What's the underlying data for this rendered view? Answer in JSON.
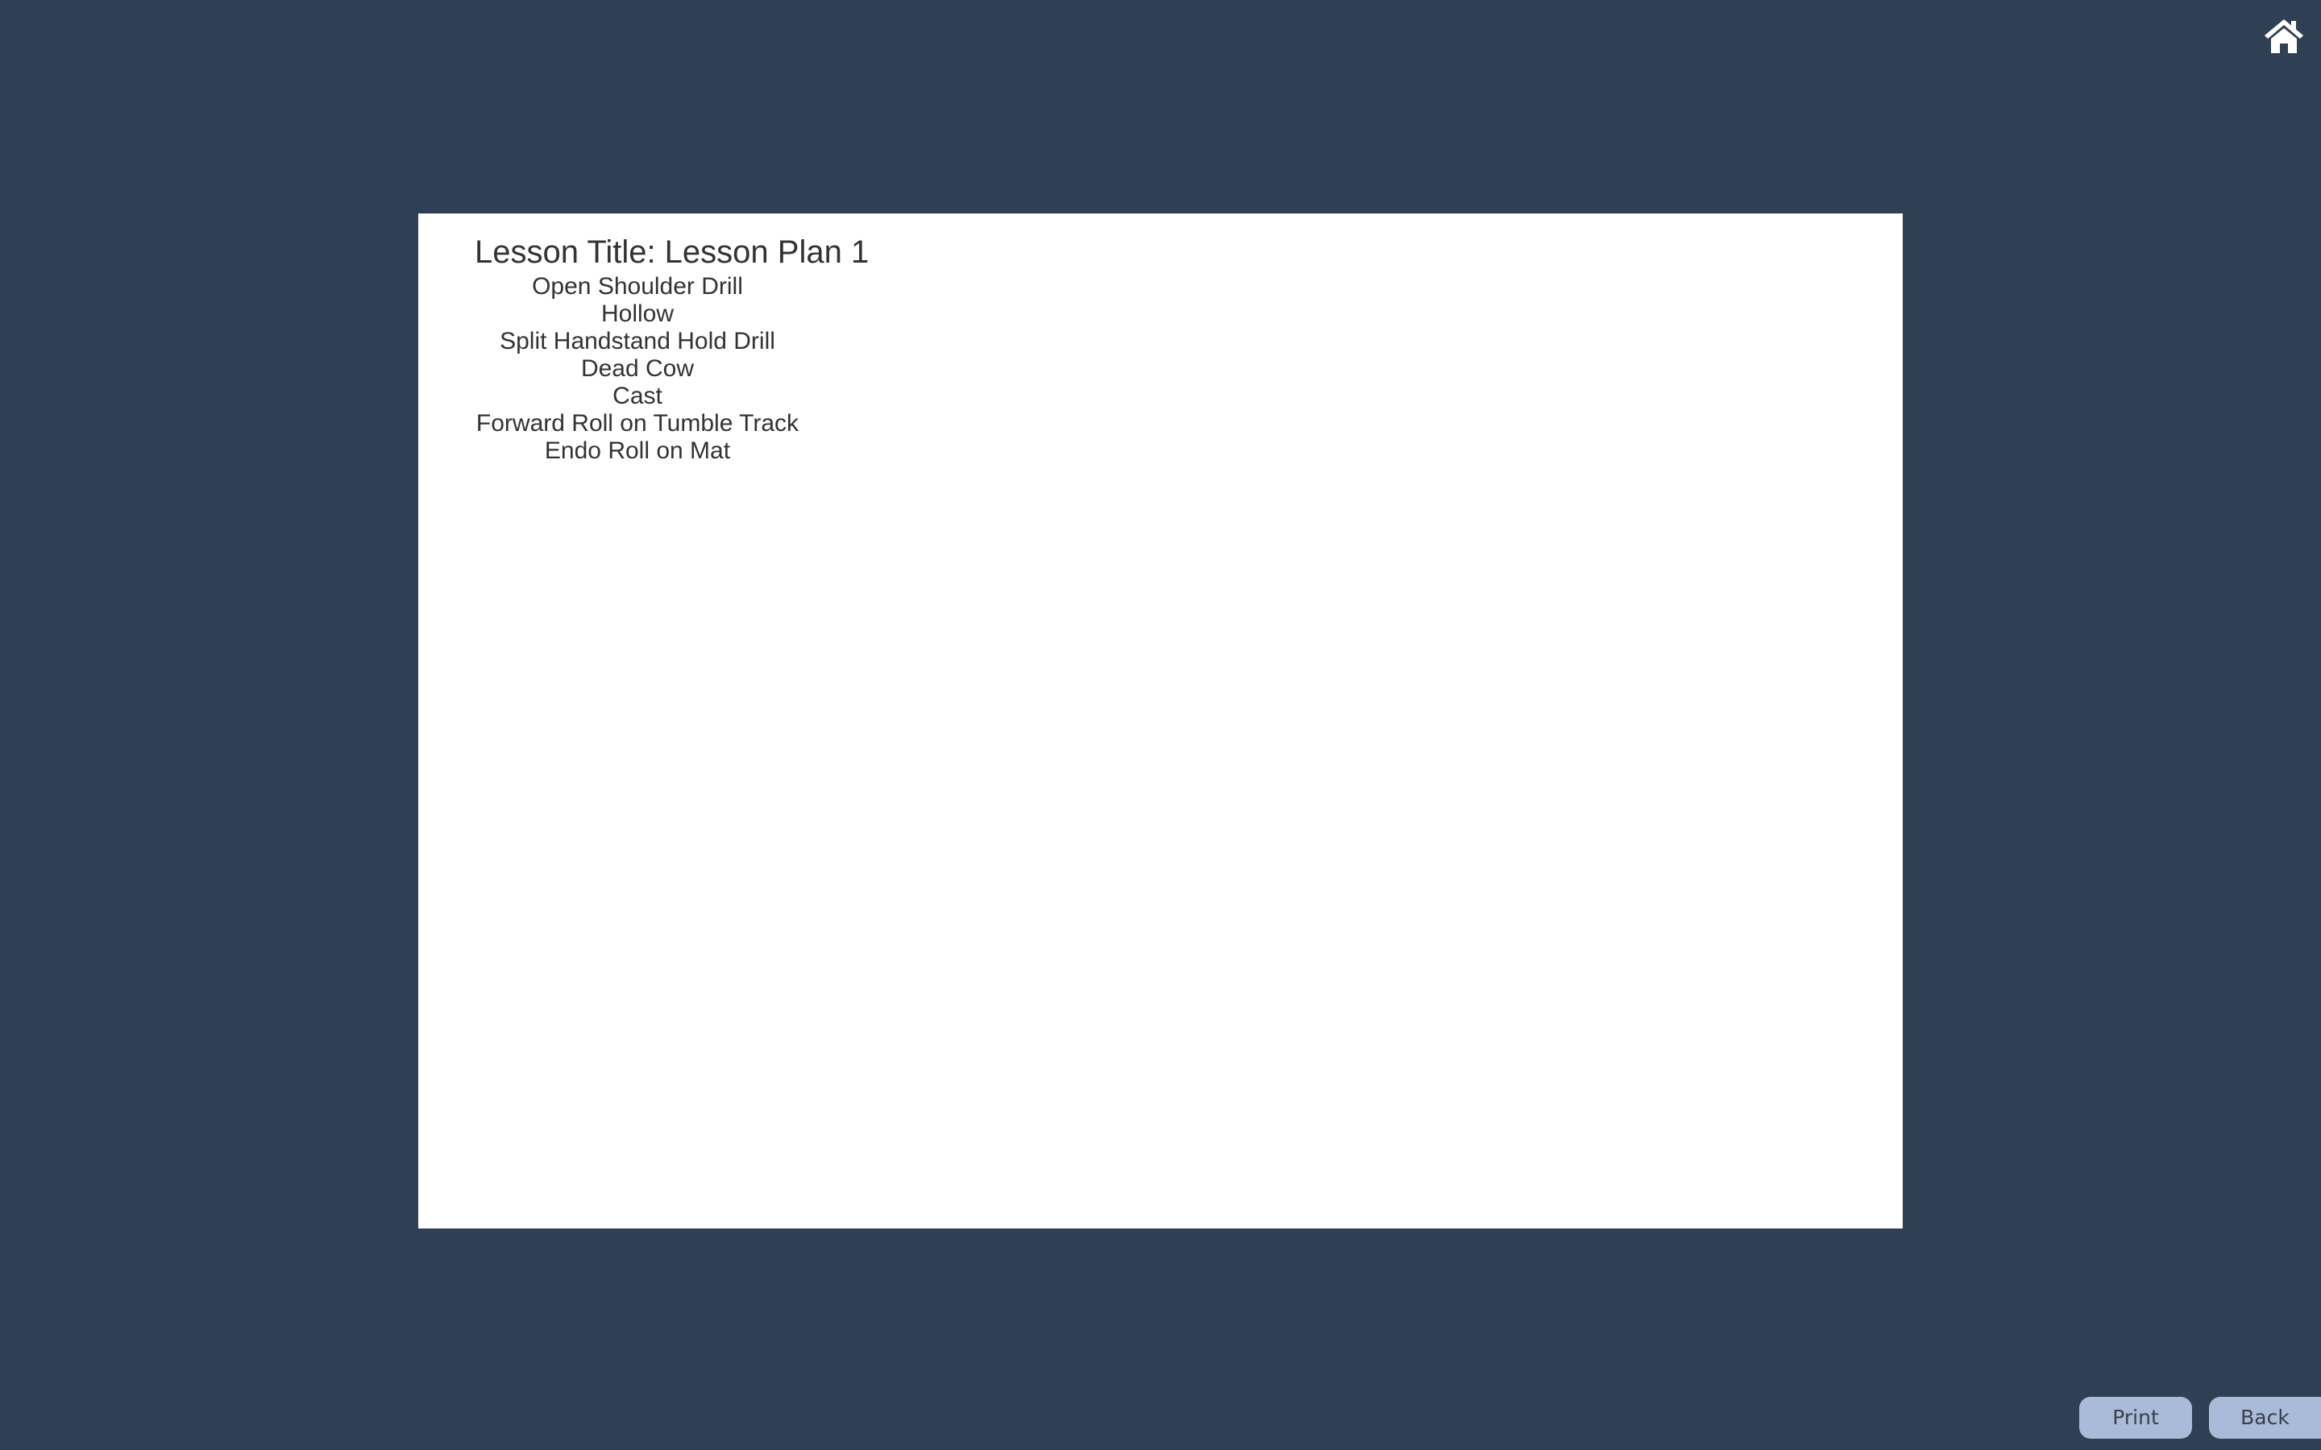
{
  "header": {
    "home_icon": "home-icon"
  },
  "lesson": {
    "title": "Lesson Title: Lesson Plan 1",
    "skills": [
      "Open Shoulder Drill",
      "Hollow",
      "Split Handstand Hold Drill",
      "Dead Cow",
      "Cast",
      "Forward Roll on Tumble Track",
      "Endo Roll on Mat"
    ]
  },
  "footer": {
    "print_label": "Print",
    "back_label": "Back"
  },
  "colors": {
    "background": "#304054",
    "sheet": "#ffffff",
    "button": "#a9bbd8",
    "text": "#333333"
  }
}
